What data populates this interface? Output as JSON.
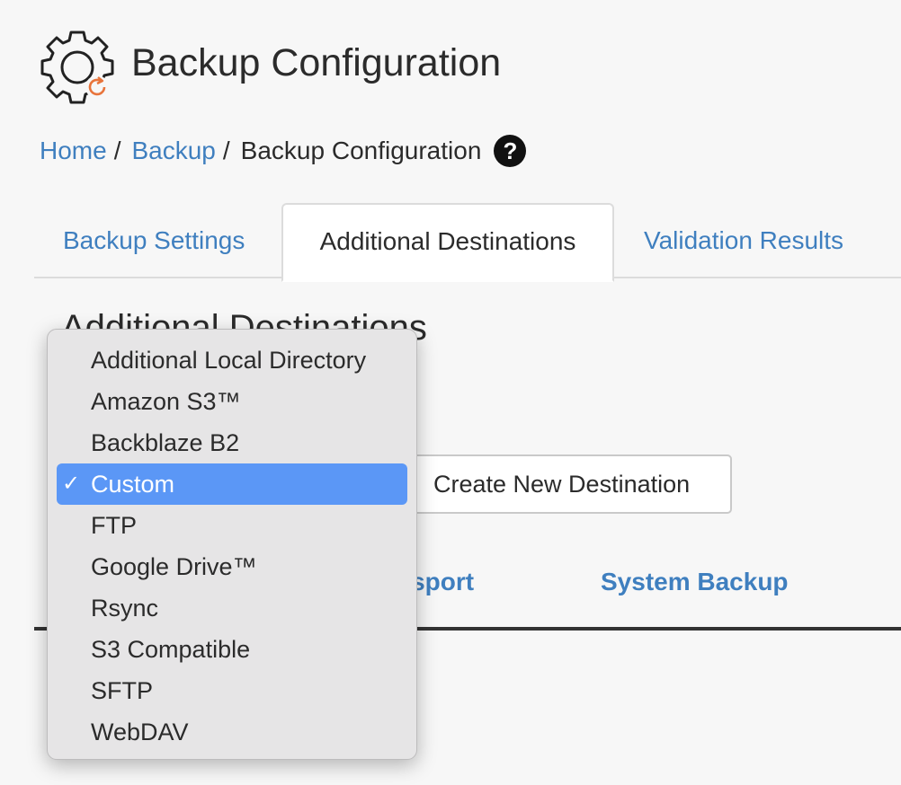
{
  "header": {
    "title": "Backup Configuration",
    "logo_icon": "gear-backup-icon"
  },
  "breadcrumb": {
    "items": [
      "Home",
      "Backup"
    ],
    "separator": "/",
    "current": "Backup Configuration",
    "help_icon": "question-circle-icon",
    "help_symbol": "?"
  },
  "tabs": [
    {
      "label": "Backup Settings",
      "active": false
    },
    {
      "label": "Additional Destinations",
      "active": true
    },
    {
      "label": "Validation Results",
      "active": false
    }
  ],
  "section": {
    "heading": "Additional Destinations",
    "create_button": "Create New Destination",
    "subtabs": [
      "nsport",
      "System Backup"
    ]
  },
  "dropdown": {
    "selected": "Custom",
    "check_symbol": "✓",
    "options": [
      "Additional Local Directory",
      "Amazon S3™",
      "Backblaze B2",
      "Custom",
      "FTP",
      "Google Drive™",
      "Rsync",
      "S3 Compatible",
      "SFTP",
      "WebDAV"
    ]
  },
  "colors": {
    "link": "#3f7fbf",
    "selection": "#5b97f6",
    "logo_accent": "#e8743b"
  }
}
